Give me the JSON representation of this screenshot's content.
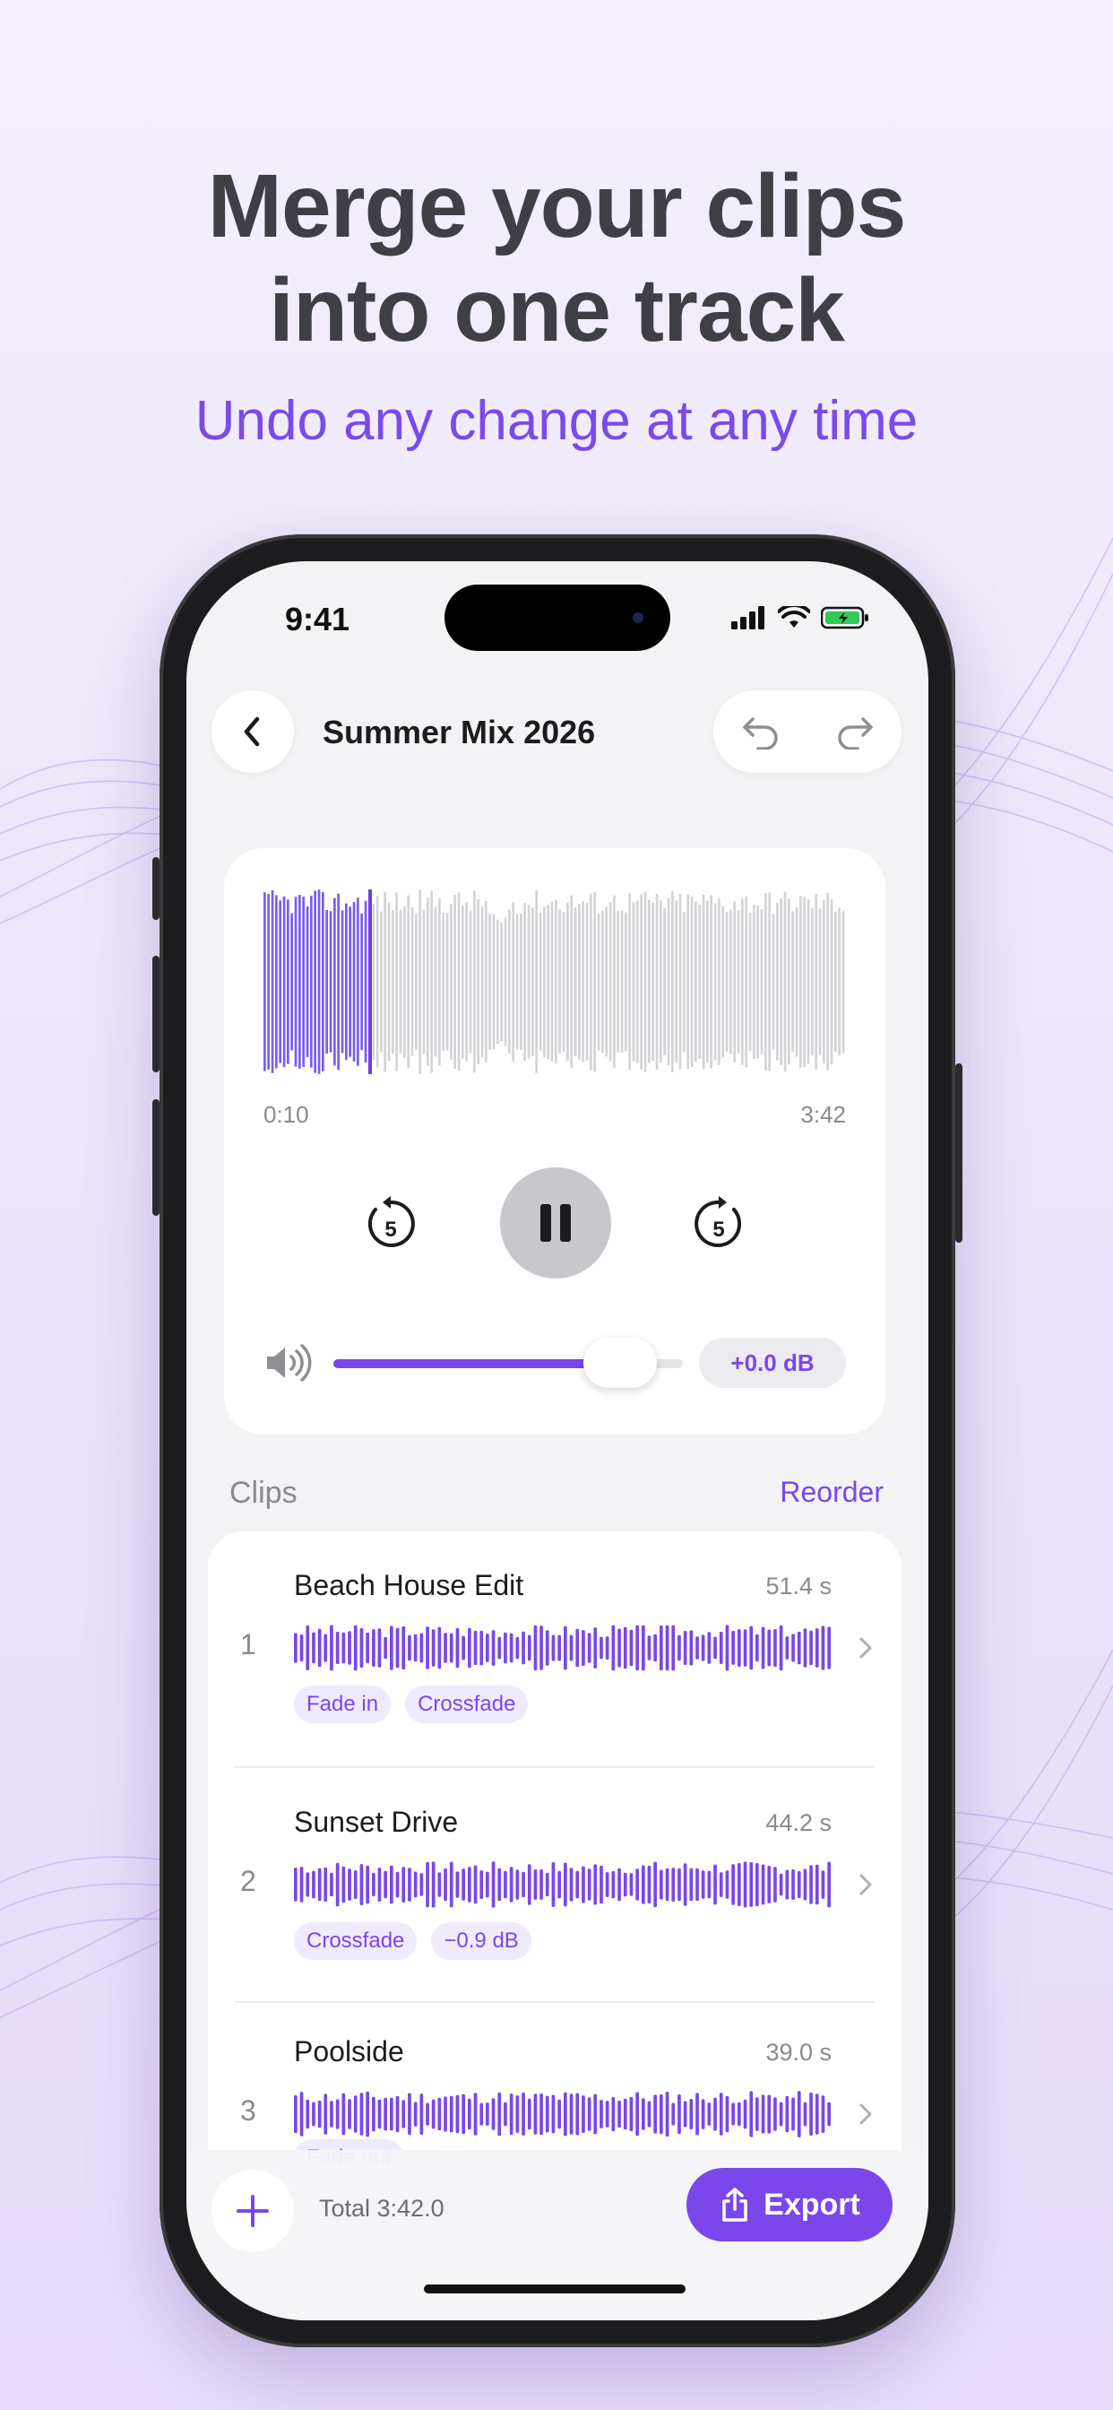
{
  "marketing": {
    "headline_line1": "Merge your clips",
    "headline_line2": "into one track",
    "subhead": "Undo any change at any time"
  },
  "status_bar": {
    "time": "9:41"
  },
  "nav": {
    "title": "Summer Mix 2026"
  },
  "player": {
    "current_time": "0:10",
    "total_time": "3:42",
    "progress_fraction": 0.18,
    "skip_back_seconds": "5",
    "skip_forward_seconds": "5",
    "volume_fraction": 0.82,
    "gain_label": "+0.0 dB"
  },
  "clips_section": {
    "header": "Clips",
    "reorder_label": "Reorder",
    "clips": [
      {
        "index": "1",
        "title": "Beach House Edit",
        "duration": "51.4 s",
        "tags": [
          "Fade in",
          "Crossfade"
        ]
      },
      {
        "index": "2",
        "title": "Sunset Drive",
        "duration": "44.2 s",
        "tags": [
          "Crossfade",
          "−0.9 dB"
        ]
      },
      {
        "index": "3",
        "title": "Poolside",
        "duration": "39.0 s",
        "tags": [
          "Fade out"
        ]
      }
    ]
  },
  "bottom_bar": {
    "total_label": "Total 3:42.0",
    "export_label": "Export"
  },
  "colors": {
    "accent": "#7b46ea",
    "waveform_played": "#7b5cf0",
    "waveform_unplayed": "#d4d4d8",
    "subhead": "#7a4bea"
  },
  "icons": [
    "back-chevron-icon",
    "undo-icon",
    "redo-icon",
    "skip-back-5-icon",
    "pause-icon",
    "skip-forward-5-icon",
    "volume-icon",
    "chevron-right-icon",
    "plus-icon",
    "share-icon",
    "signal-icon",
    "wifi-icon",
    "battery-icon"
  ]
}
